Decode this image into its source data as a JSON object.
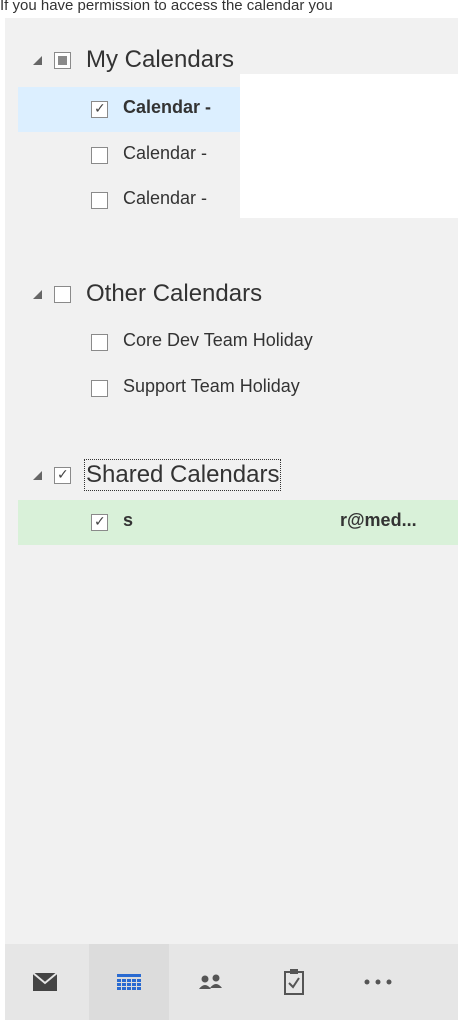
{
  "top_text": "If you have permission to access the calendar you",
  "groups": {
    "my_calendars": {
      "label": "My Calendars",
      "items": [
        {
          "label": "Calendar -",
          "checked": true,
          "selected": true
        },
        {
          "label": "Calendar -",
          "checked": false
        },
        {
          "label": "Calendar -",
          "checked": false
        }
      ]
    },
    "other_calendars": {
      "label": "Other Calendars",
      "items": [
        {
          "label": "Core Dev Team Holiday",
          "checked": false
        },
        {
          "label": "Support Team Holiday",
          "checked": false
        }
      ]
    },
    "shared_calendars": {
      "label": "Shared Calendars",
      "items": [
        {
          "label_left": "s",
          "label_right": "r@med...",
          "checked": true,
          "selected": true
        }
      ]
    }
  },
  "bottom_nav": {
    "items": [
      {
        "icon": "mail-icon",
        "active": false
      },
      {
        "icon": "calendar-icon",
        "active": true
      },
      {
        "icon": "people-icon",
        "active": false
      },
      {
        "icon": "tasks-icon",
        "active": false
      },
      {
        "icon": "more-icon",
        "active": false
      }
    ]
  },
  "colors": {
    "pane_bg": "#f1f1f1",
    "selected_blue": "#dcefff",
    "selected_green": "#d9f1d9",
    "calendar_icon": "#2a6bd1"
  }
}
